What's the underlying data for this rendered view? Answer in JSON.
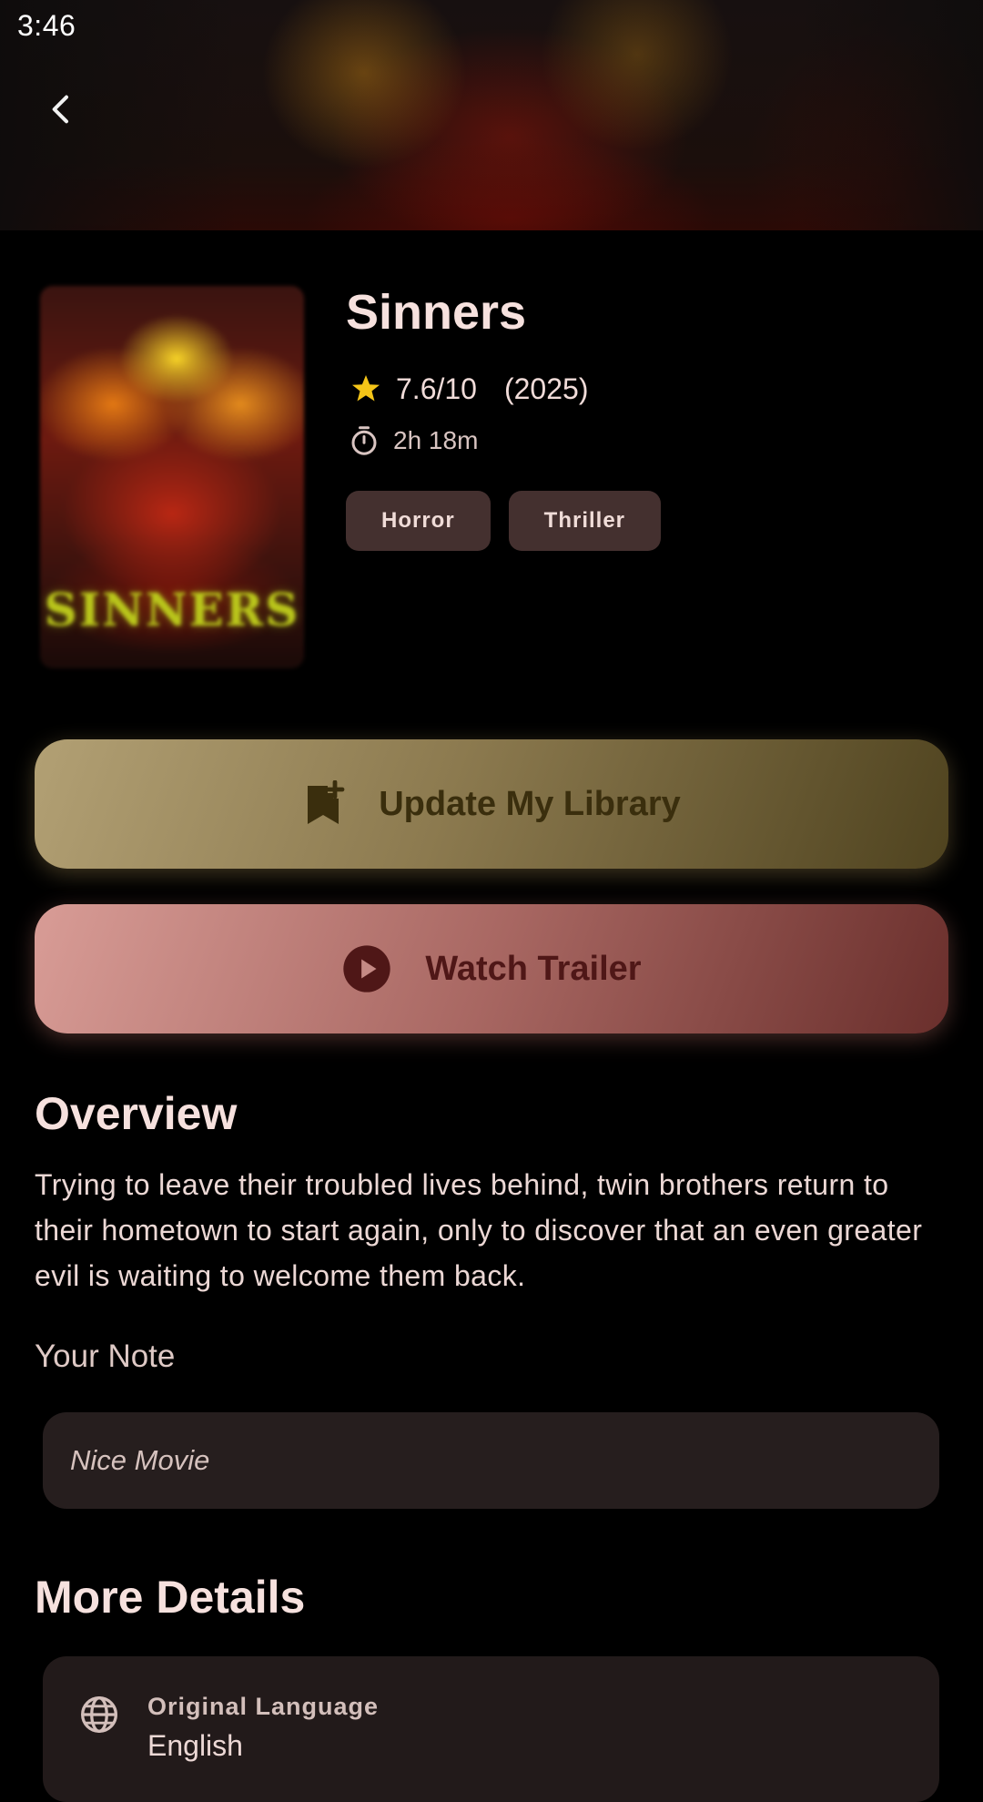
{
  "status_bar": {
    "time": "3:46"
  },
  "header": {
    "back_icon": "chevron-left-icon"
  },
  "movie": {
    "poster_text": "SINNERS",
    "title": "Sinners",
    "rating": "7.6/10",
    "year": "(2025)",
    "runtime": "2h 18m",
    "genres": [
      "Horror",
      "Thriller"
    ]
  },
  "actions": {
    "library_label": "Update My Library",
    "library_icon": "bookmark-add-icon",
    "trailer_label": "Watch Trailer",
    "trailer_icon": "play-circle-icon"
  },
  "overview": {
    "heading": "Overview",
    "text": "Trying to leave their troubled lives behind, twin brothers return to their hometown to start again, only to discover that an even greater evil is waiting to welcome them back."
  },
  "note": {
    "label": "Your Note",
    "value": "Nice Movie"
  },
  "more_details": {
    "heading": "More Details",
    "items": [
      {
        "icon": "globe-icon",
        "label": "Original Language",
        "value": "English"
      }
    ]
  },
  "colors": {
    "background": "#000000",
    "chip": "#44302f",
    "library_button": "#b2a074",
    "trailer_button": "#d89c96",
    "star": "#f5c518"
  }
}
